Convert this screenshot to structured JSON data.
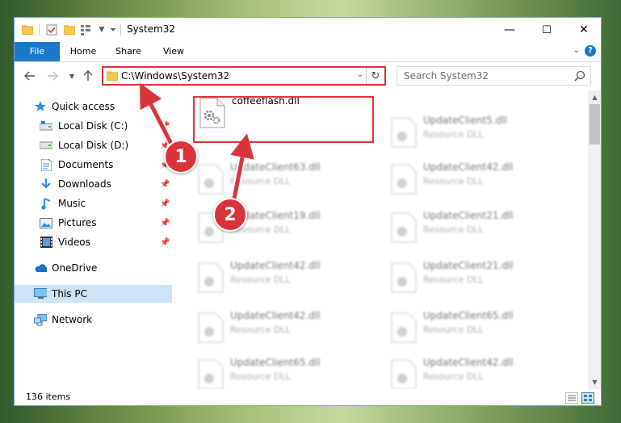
{
  "window": {
    "title": "System32",
    "controls": {
      "minimize": "—",
      "maximize": "☐",
      "close": "✕"
    }
  },
  "ribbon": {
    "tabs": [
      {
        "label": "File",
        "active": true
      },
      {
        "label": "Home"
      },
      {
        "label": "Share"
      },
      {
        "label": "View"
      }
    ]
  },
  "address_bar": {
    "path": "C:\\Windows\\System32"
  },
  "search": {
    "placeholder": "Search System32"
  },
  "sidebar": {
    "items": [
      {
        "label": "Quick access",
        "icon": "star-icon",
        "pinned": false
      },
      {
        "label": "Local Disk (C:)",
        "icon": "drive-icon",
        "pinned": true
      },
      {
        "label": "Local Disk (D:)",
        "icon": "drive-icon",
        "pinned": true
      },
      {
        "label": "Documents",
        "icon": "documents-icon",
        "pinned": true
      },
      {
        "label": "Downloads",
        "icon": "download-icon",
        "pinned": true
      },
      {
        "label": "Music",
        "icon": "music-icon",
        "pinned": true
      },
      {
        "label": "Pictures",
        "icon": "pictures-icon",
        "pinned": true
      },
      {
        "label": "Videos",
        "icon": "videos-icon",
        "pinned": true
      },
      {
        "label": "OneDrive",
        "icon": "cloud-icon",
        "pinned": false
      },
      {
        "label": "This PC",
        "icon": "computer-icon",
        "pinned": false,
        "selected": true
      },
      {
        "label": "Network",
        "icon": "network-icon",
        "pinned": false
      }
    ]
  },
  "files": {
    "highlighted": {
      "name": "coffeeflash.dll",
      "type": ""
    },
    "left_column": [
      {
        "name": "UpdateClient63.dll",
        "type": "Resource DLL"
      },
      {
        "name": "UpdateClient19.dll",
        "type": "Resource DLL"
      },
      {
        "name": "UpdateClient42.dll",
        "type": "Resource DLL"
      },
      {
        "name": "UpdateClient42.dll",
        "type": "Resource DLL"
      },
      {
        "name": "UpdateClient65.dll",
        "type": "Resource DLL"
      }
    ],
    "right_column": [
      {
        "name": "UpdateClient5.dll",
        "type": "Resource DLL"
      },
      {
        "name": "UpdateClient42.dll",
        "type": "Resource DLL"
      },
      {
        "name": "UpdateClient21.dll",
        "type": "Resource DLL"
      },
      {
        "name": "UpdateClient21.dll",
        "type": "Resource DLL"
      },
      {
        "name": "UpdateClient65.dll",
        "type": "Resource DLL"
      },
      {
        "name": "UpdateClient42.dll",
        "type": "Resource DLL"
      }
    ]
  },
  "status": {
    "item_count": "136 items"
  },
  "annotations": {
    "step1": "1",
    "step2": "2"
  },
  "colors": {
    "accent": "#1979ca",
    "highlight_red": "#d9343a",
    "selection": "#cce4f7"
  }
}
